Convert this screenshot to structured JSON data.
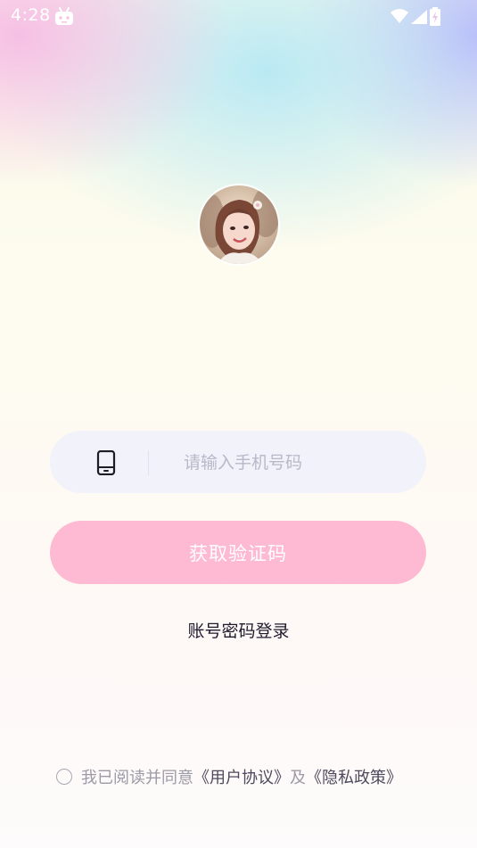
{
  "status_bar": {
    "time": "4:28",
    "icons": [
      "robot-icon",
      "wifi-icon",
      "signal-icon",
      "battery-charging-icon"
    ]
  },
  "avatar": {
    "description": "user-avatar-photo"
  },
  "login": {
    "phone_placeholder": "请输入手机号码",
    "phone_value": "",
    "phone_icon": "mobile-phone-icon",
    "get_code_label": "获取验证码",
    "password_login_label": "账号密码登录"
  },
  "agreement": {
    "prefix": "我已阅读并同意",
    "user_agreement": "《用户协议》",
    "and": "及",
    "privacy_policy": "《隐私政策》",
    "checked": false
  },
  "colors": {
    "primary_button": "#fdbad2",
    "input_background": "#f1f2fa",
    "placeholder": "#b7b9c8",
    "text_dark": "#1f1b2e",
    "agreement_text": "#9c9aa6"
  }
}
